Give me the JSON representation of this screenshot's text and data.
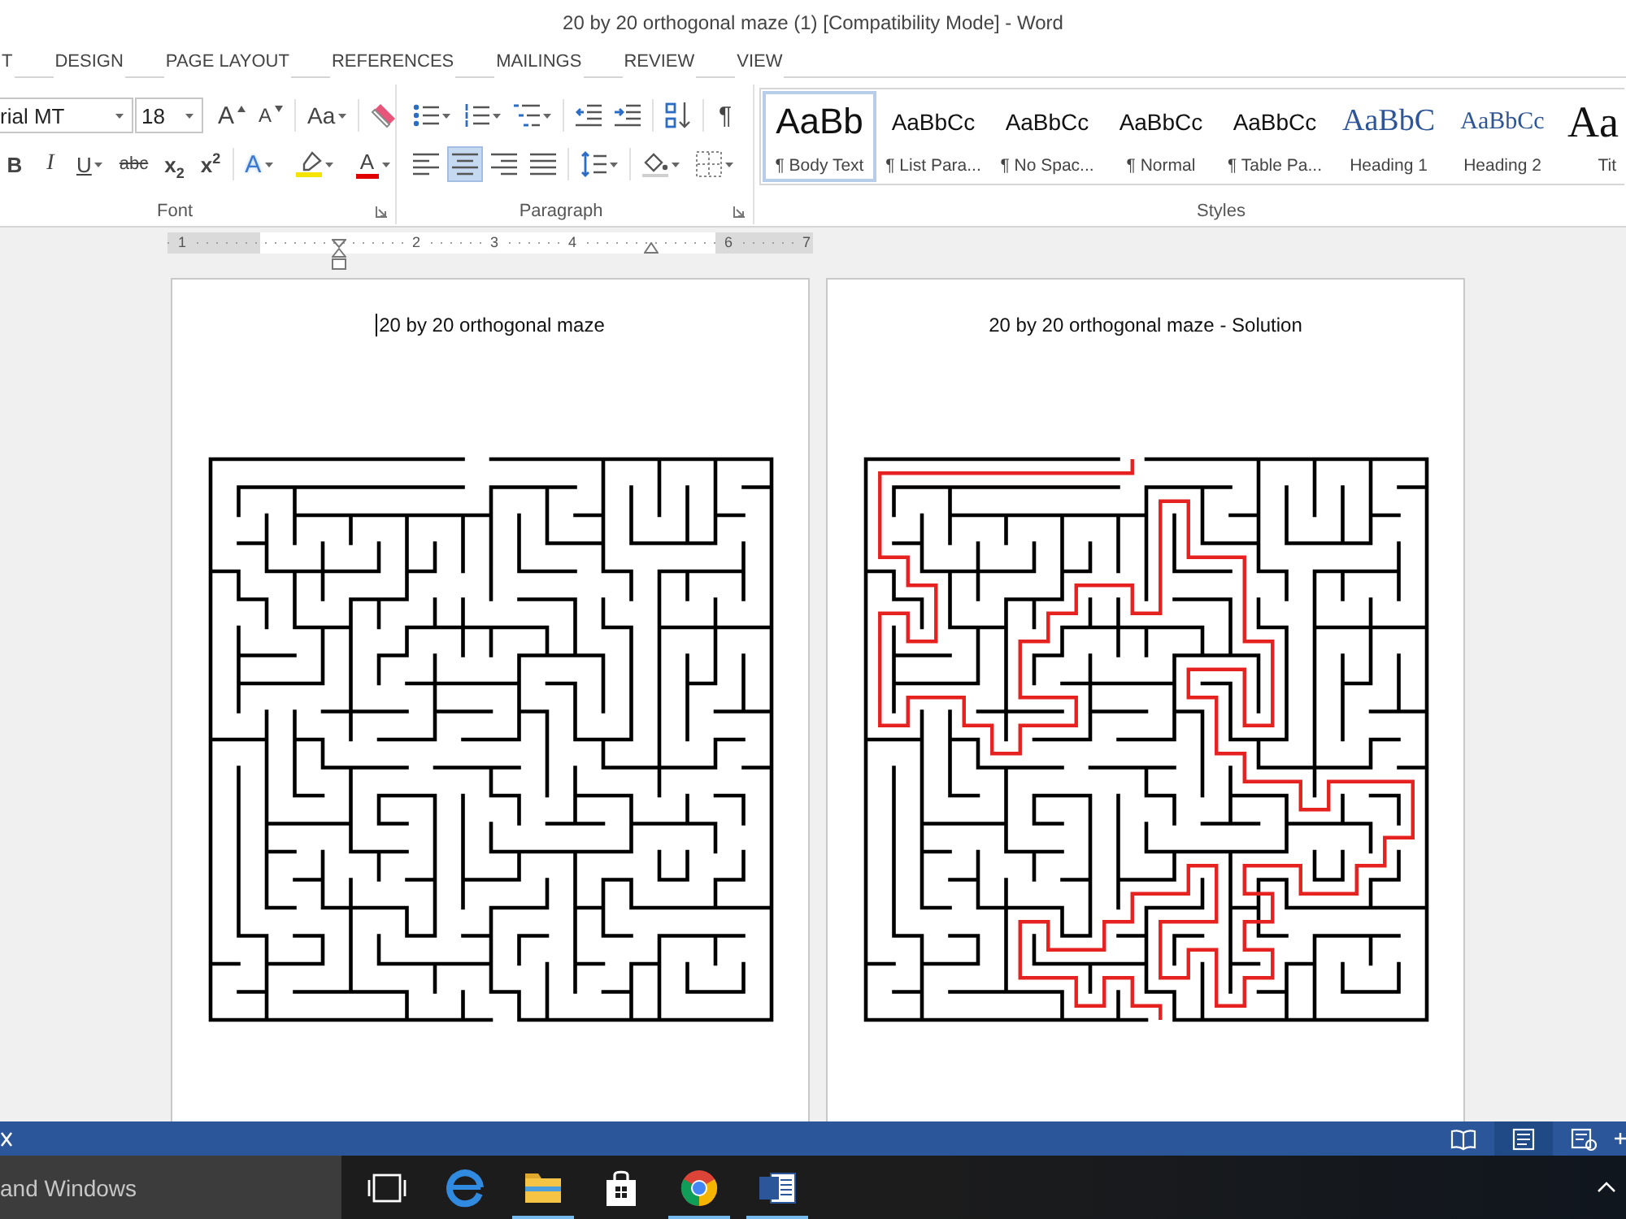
{
  "window": {
    "title": "20 by 20 orthogonal maze (1) [Compatibility Mode] - Word"
  },
  "ribbon_tabs": [
    {
      "label": "T",
      "selected": false
    },
    {
      "label": "DESIGN",
      "selected": false
    },
    {
      "label": "PAGE LAYOUT",
      "selected": false
    },
    {
      "label": "REFERENCES",
      "selected": false
    },
    {
      "label": "MAILINGS",
      "selected": false
    },
    {
      "label": "REVIEW",
      "selected": false
    },
    {
      "label": "VIEW",
      "selected": false
    }
  ],
  "ribbon": {
    "font": {
      "label": "Font",
      "font_name": "rial MT",
      "font_size": "18",
      "rows": [
        [
          [
            {
              "kind": "grow",
              "text": "A"
            },
            {
              "kind": "shrink",
              "text": "A"
            }
          ],
          [
            {
              "kind": "case",
              "text": "Aa",
              "dropdown": true
            }
          ],
          [
            {
              "kind": "clear"
            }
          ]
        ],
        [
          [
            {
              "kind": "bold",
              "text": "B"
            },
            {
              "kind": "italic",
              "text": "I"
            },
            {
              "kind": "underline",
              "text": "U",
              "dropdown": true
            },
            {
              "kind": "strike",
              "text": "abc"
            },
            {
              "kind": "subscript",
              "text": "x$_{2}$"
            },
            {
              "kind": "superscript",
              "text": "x$^{2}$"
            }
          ],
          [
            {
              "kind": "effects",
              "text": "A",
              "dropdown": true
            },
            {
              "kind": "highlight",
              "dropdown": true
            },
            {
              "kind": "color",
              "text": "A",
              "dropdown": true
            }
          ]
        ]
      ]
    },
    "paragraph": {
      "label": "Paragraph",
      "rows": [
        [
          [
            {
              "kind": "bullets",
              "dropdown": true
            },
            {
              "kind": "numbering",
              "dropdown": true
            },
            {
              "kind": "multilevel",
              "dropdown": true
            }
          ],
          [
            {
              "kind": "outdent"
            },
            {
              "kind": "indent"
            }
          ],
          [
            {
              "kind": "sort"
            }
          ],
          [
            {
              "kind": "pilcrow",
              "text": "¶"
            }
          ]
        ],
        [
          [
            {
              "kind": "align-left",
              "selected": false
            },
            {
              "kind": "align-center",
              "selected": true
            },
            {
              "kind": "align-right",
              "selected": false
            },
            {
              "kind": "justify",
              "selected": false
            }
          ],
          [
            {
              "kind": "line-spacing",
              "dropdown": true
            }
          ],
          [
            {
              "kind": "shading",
              "dropdown": true
            },
            {
              "kind": "borders",
              "dropdown": true
            }
          ]
        ]
      ]
    },
    "styles": {
      "label": "Styles",
      "items": [
        {
          "kind": "body",
          "preview": "AaBb",
          "name": "¶ Body Text",
          "selected": true
        },
        {
          "kind": "normal",
          "preview": "AaBbCc",
          "name": "¶ List Para...",
          "selected": false
        },
        {
          "kind": "normal",
          "preview": "AaBbCc",
          "name": "¶ No Spac...",
          "selected": false
        },
        {
          "kind": "normal",
          "preview": "AaBbCc",
          "name": "¶ Normal",
          "selected": false
        },
        {
          "kind": "normal",
          "preview": "AaBbCc",
          "name": "¶ Table Pa...",
          "selected": false
        },
        {
          "kind": "heading1",
          "preview": "AaBbC",
          "name": "Heading 1",
          "selected": false
        },
        {
          "kind": "heading2",
          "preview": "AaBbCc",
          "name": "Heading 2",
          "selected": false
        },
        {
          "kind": "title",
          "preview": "Aa",
          "name": "Tit",
          "selected": false
        }
      ]
    }
  },
  "ruler": {
    "marks": [
      {
        "kind": "number",
        "label": "1"
      },
      {
        "kind": "blank"
      },
      {
        "kind": "indent"
      },
      {
        "kind": "number",
        "label": "2"
      },
      {
        "kind": "number",
        "label": "3"
      },
      {
        "kind": "number",
        "label": "4"
      },
      {
        "kind": "right_indent"
      },
      {
        "kind": "number",
        "label": "6"
      },
      {
        "kind": "number",
        "label": "7"
      }
    ]
  },
  "pages": [
    {
      "kind": "maze",
      "title": "20 by 20 orthogonal maze",
      "cursor": true
    },
    {
      "kind": "solution",
      "title": "20 by 20 orthogonal maze - Solution",
      "cursor": false
    }
  ],
  "status_bar": {
    "views": [
      {
        "kind": "read",
        "selected": false
      },
      {
        "kind": "print",
        "selected": true
      },
      {
        "kind": "web",
        "selected": false
      }
    ]
  },
  "taskbar": {
    "search": {
      "placeholder": "and Windows"
    },
    "apps": [
      {
        "kind": "task_view",
        "running": false
      },
      {
        "kind": "edge",
        "running": false
      },
      {
        "kind": "explorer",
        "running": true
      },
      {
        "kind": "store",
        "running": false
      },
      {
        "kind": "chrome",
        "running": true
      },
      {
        "kind": "word",
        "running": true
      }
    ]
  }
}
